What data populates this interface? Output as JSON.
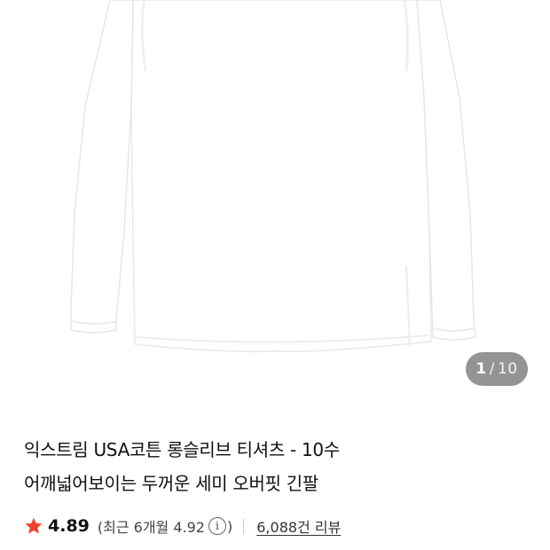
{
  "gallery": {
    "current": "1",
    "separator": "/",
    "total": "10",
    "image_icon": "long-sleeve-tshirt-photo"
  },
  "product": {
    "title_line1": "익스트림 USA코튼 롱슬리브 티셔츠 - 10수",
    "title_line2": "어깨넓어보이는 두꺼운 세미 오버핏 긴팔"
  },
  "rating": {
    "star_icon": "star-icon",
    "star_color": "#f0422e",
    "score": "4.89",
    "recent_open": "(최근 6개월 4.92",
    "info_symbol": "i",
    "recent_close": ")",
    "review_count": "6,088건 리뷰"
  }
}
